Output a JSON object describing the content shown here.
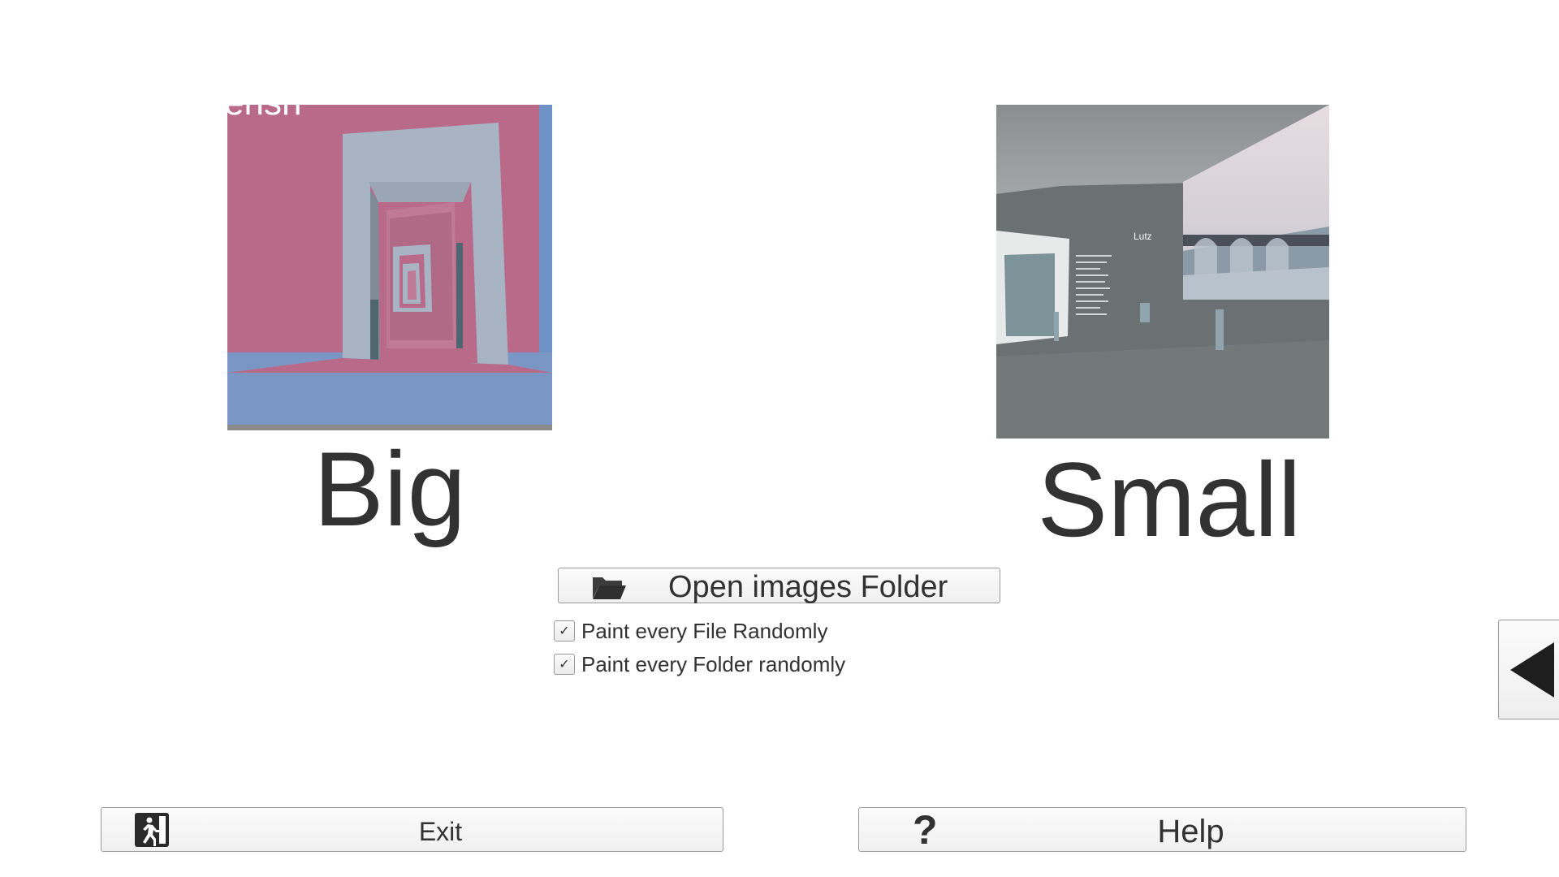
{
  "modes": {
    "big_label": "Big",
    "small_label": "Small"
  },
  "previews": {
    "big_wall_text": "ensh",
    "small_name_text": "Lutz"
  },
  "open_folder": {
    "label": "Open images Folder",
    "icon": "folder-open-icon"
  },
  "options": {
    "paint_file_label": "Paint every File Randomly",
    "paint_file_checked": true,
    "paint_folder_label": "Paint every Folder randomly",
    "paint_folder_checked": true,
    "check_glyph": "✓"
  },
  "side_panel": {
    "icon": "triangle-left-icon"
  },
  "footer": {
    "exit_label": "Exit",
    "exit_icon": "exit-icon",
    "help_label": "Help",
    "help_icon": "question-mark-icon",
    "help_glyph": "?"
  },
  "colors": {
    "background": "#ffffff",
    "text": "#323232",
    "button_border": "#9a9a9a"
  }
}
